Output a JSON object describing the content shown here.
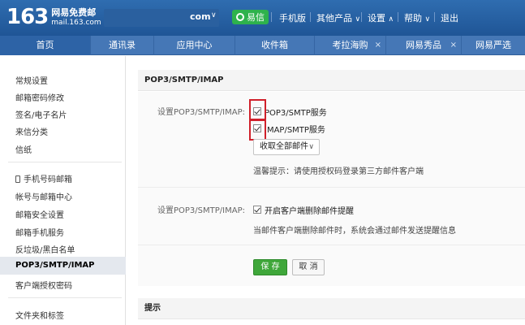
{
  "header": {
    "logo_number": "163",
    "logo_title": "网易免费邮",
    "logo_domain": "mail.163.com",
    "account_suffix": "com",
    "account_caret": "∨",
    "yixin_label": "易信",
    "mobile_label": "手机版",
    "other_products_label": "其他产品",
    "settings_label": "设置",
    "help_label": "帮助",
    "logout_label": "退出",
    "caret_down": "∨",
    "caret_up": "∧"
  },
  "tabs": [
    {
      "label": "首页"
    },
    {
      "label": "通讯录"
    },
    {
      "label": "应用中心"
    },
    {
      "label": "收件箱"
    },
    {
      "label": "考拉海购",
      "close": "×"
    },
    {
      "label": "网易秀品",
      "close": "×"
    },
    {
      "label": "网易严选"
    }
  ],
  "sidebar": {
    "items": [
      "常规设置",
      "邮箱密码修改",
      "签名/电子名片",
      "来信分类",
      "信纸",
      "手机号码邮箱",
      "帐号与邮箱中心",
      "邮箱安全设置",
      "邮箱手机服务",
      "反垃圾/黑白名单",
      "POP3/SMTP/IMAP",
      "客户端授权密码",
      "文件夹和标签"
    ]
  },
  "main": {
    "section_title": "POP3/SMTP/IMAP",
    "row1_label": "设置POP3/SMTP/IMAP:",
    "pop3_label": "POP3/SMTP服务",
    "imap_label": "IMAP/SMTP服务",
    "receive_select": "收取全部邮件",
    "tip_text": "温馨提示：请使用授权码登录第三方邮件客户端",
    "row2_label": "设置POP3/SMTP/IMAP:",
    "delete_reminder_label": "开启客户端删除邮件提醒",
    "delete_reminder_desc": "当邮件客户端删除邮件时，系统会通过邮件发送提醒信息",
    "save_label": "保 存",
    "cancel_label": "取 消",
    "tips_title": "提示"
  }
}
